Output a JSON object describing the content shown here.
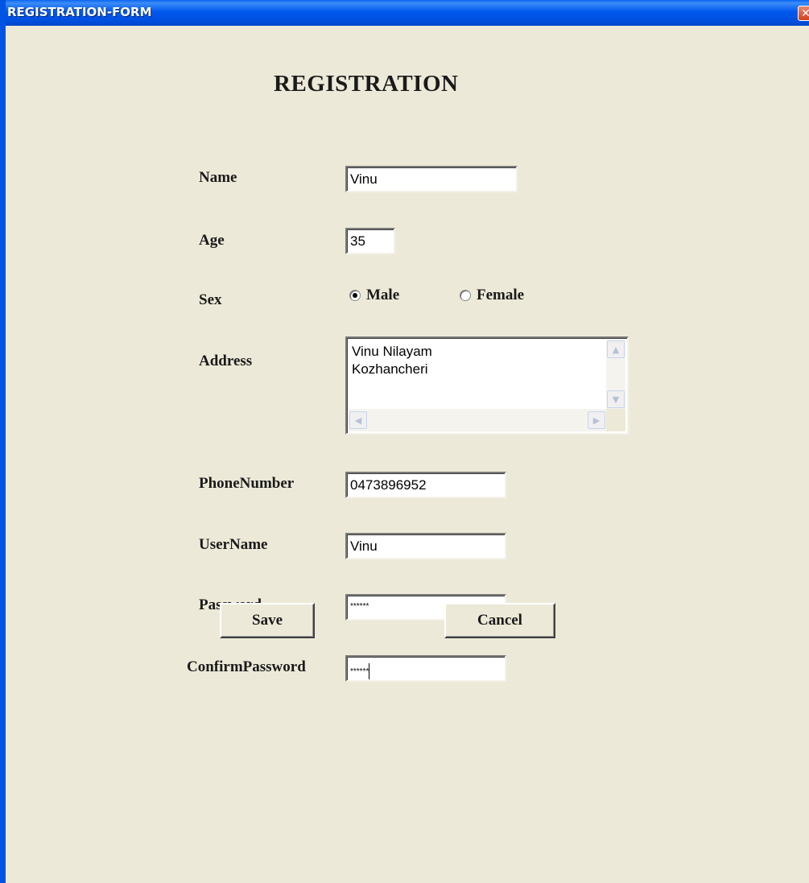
{
  "window": {
    "title": "REGISTRATION-FORM",
    "close_glyph": "✕"
  },
  "form": {
    "heading": "REGISTRATION",
    "name_label": "Name",
    "name_value": "Vinu",
    "age_label": "Age",
    "age_value": "35",
    "sex_label": "Sex",
    "sex_options": [
      "Male",
      "Female"
    ],
    "sex_selected": "Male",
    "address_label": "Address",
    "address_lines": [
      "Vinu Nilayam",
      "Kozhancheri"
    ],
    "phone_label": "PhoneNumber",
    "phone_value": "0473896952",
    "username_label": "UserName",
    "username_value": "Vinu",
    "password_label": "Password",
    "password_value": "******",
    "confirm_label": "ConfirmPassword",
    "confirm_value": "******",
    "save_label": "Save",
    "cancel_label": "Cancel"
  },
  "colors": {
    "window_bg": "#ece9d8",
    "titlebar": "#0058ee",
    "close_button": "#d0421f"
  }
}
